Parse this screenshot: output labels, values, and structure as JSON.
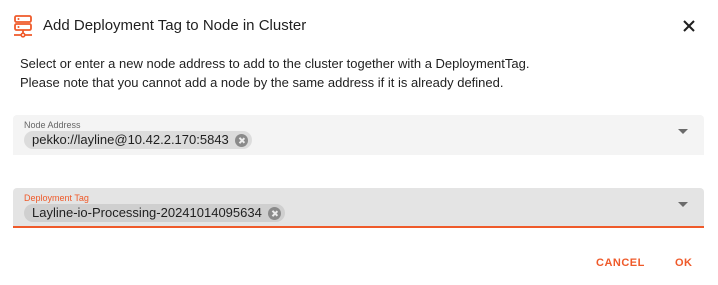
{
  "dialog": {
    "title": "Add Deployment Tag to Node in Cluster",
    "title_icon": "server-icon",
    "close_icon": "close-icon",
    "description_line1": "Select or enter a new node address to add to the cluster together with a DeploymentTag.",
    "description_line2": "Please note that you cannot add a node by the same address if it is already defined."
  },
  "node_address": {
    "label": "Node Address",
    "chip_value": "pekko://layline@10.42.2.170:5843"
  },
  "deployment_tag": {
    "label": "Deployment Tag",
    "chip_value": "Layline-io-Processing-20241014095634"
  },
  "actions": {
    "cancel_label": "CANCEL",
    "ok_label": "OK"
  },
  "colors": {
    "accent": "#ef5a2a",
    "text": "#1f1f1f",
    "field_bg": "#f4f4f4",
    "field_focused_bg": "#e4e4e4"
  }
}
